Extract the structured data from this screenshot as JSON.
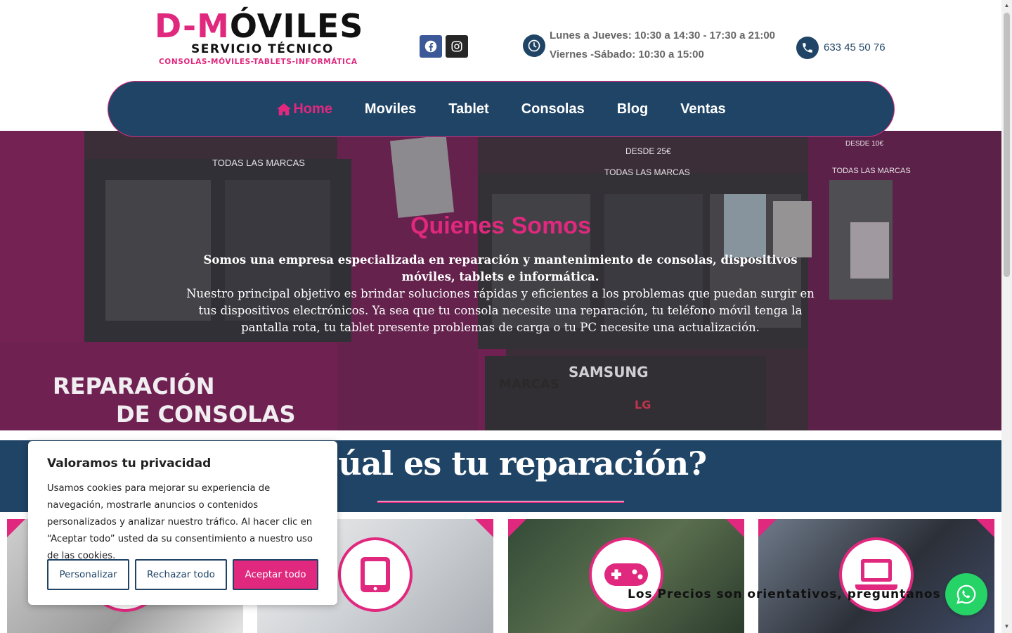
{
  "header": {
    "logo_prefix": "D-",
    "logo_accent": "M",
    "logo_rest": "ÓVILES",
    "logo_subtitle": "SERVICIO TÉCNICO",
    "logo_tagline": "CONSOLAS-MÓVILES-TABLETS-INFORMÁTICA",
    "social": [
      {
        "icon": "facebook-icon",
        "color": "#3b5998"
      },
      {
        "icon": "instagram-icon",
        "color": "#262626"
      }
    ],
    "hours_line1": "Lunes a Jueves: 10:30 a 14:30 - 17:30 a 21:00",
    "hours_line2": "Viernes -Sábado: 10:30 a 15:00",
    "phone": "633 45 50 76"
  },
  "nav": {
    "items": [
      {
        "label": "Home",
        "active": true
      },
      {
        "label": "Moviles"
      },
      {
        "label": "Tablet"
      },
      {
        "label": "Consolas"
      },
      {
        "label": "Blog"
      },
      {
        "label": "Ventas"
      }
    ]
  },
  "hero": {
    "title": "Quienes Somos",
    "intro": "Somos una empresa especializada en reparación y mantenimiento de consolas, dispositivos móviles, tablets e informática.",
    "body": "Nuestro principal objetivo es brindar soluciones rápidas y eficientes a los problemas que puedan surgir en tus dispositivos electrónicos. Ya sea que tu consola necesite una reparación, tu teléfono móvil tenga la pantalla rota, tu tablet presente problemas de carga o tu PC necesite una actualización.",
    "photo_signs": {
      "repair_line1": "REPARACIÓN",
      "repair_line2": "DE CONSOLAS",
      "all_brands": "TODAS LAS MARCAS",
      "desde_25": "DESDE 25€",
      "desde_10": "DESDE 10€",
      "samsung": "SAMSUNG",
      "marcas": "MARCAS",
      "lg": "LG"
    }
  },
  "repair": {
    "title": "¿Cúal es tu reparación?",
    "cards": [
      {
        "icon": "phone-icon"
      },
      {
        "icon": "tablet-icon"
      },
      {
        "icon": "gamepad-icon"
      },
      {
        "icon": "laptop-icon"
      }
    ],
    "note": "Los Precios son orientativos, preguntanos"
  },
  "cookie": {
    "title": "Valoramos tu privacidad",
    "text": "Usamos cookies para mejorar su experiencia de navegación, mostrarle anuncios o contenidos personalizados y analizar nuestro tráfico. Al hacer clic en “Aceptar todo” usted da su consentimiento a nuestro uso de las cookies.",
    "btn_customize": "Personalizar",
    "btn_reject": "Rechazar todo",
    "btn_accept": "Aceptar todo"
  },
  "colors": {
    "brand_pink": "#e0287e",
    "brand_navy": "#1f4466",
    "whatsapp": "#25d366"
  }
}
